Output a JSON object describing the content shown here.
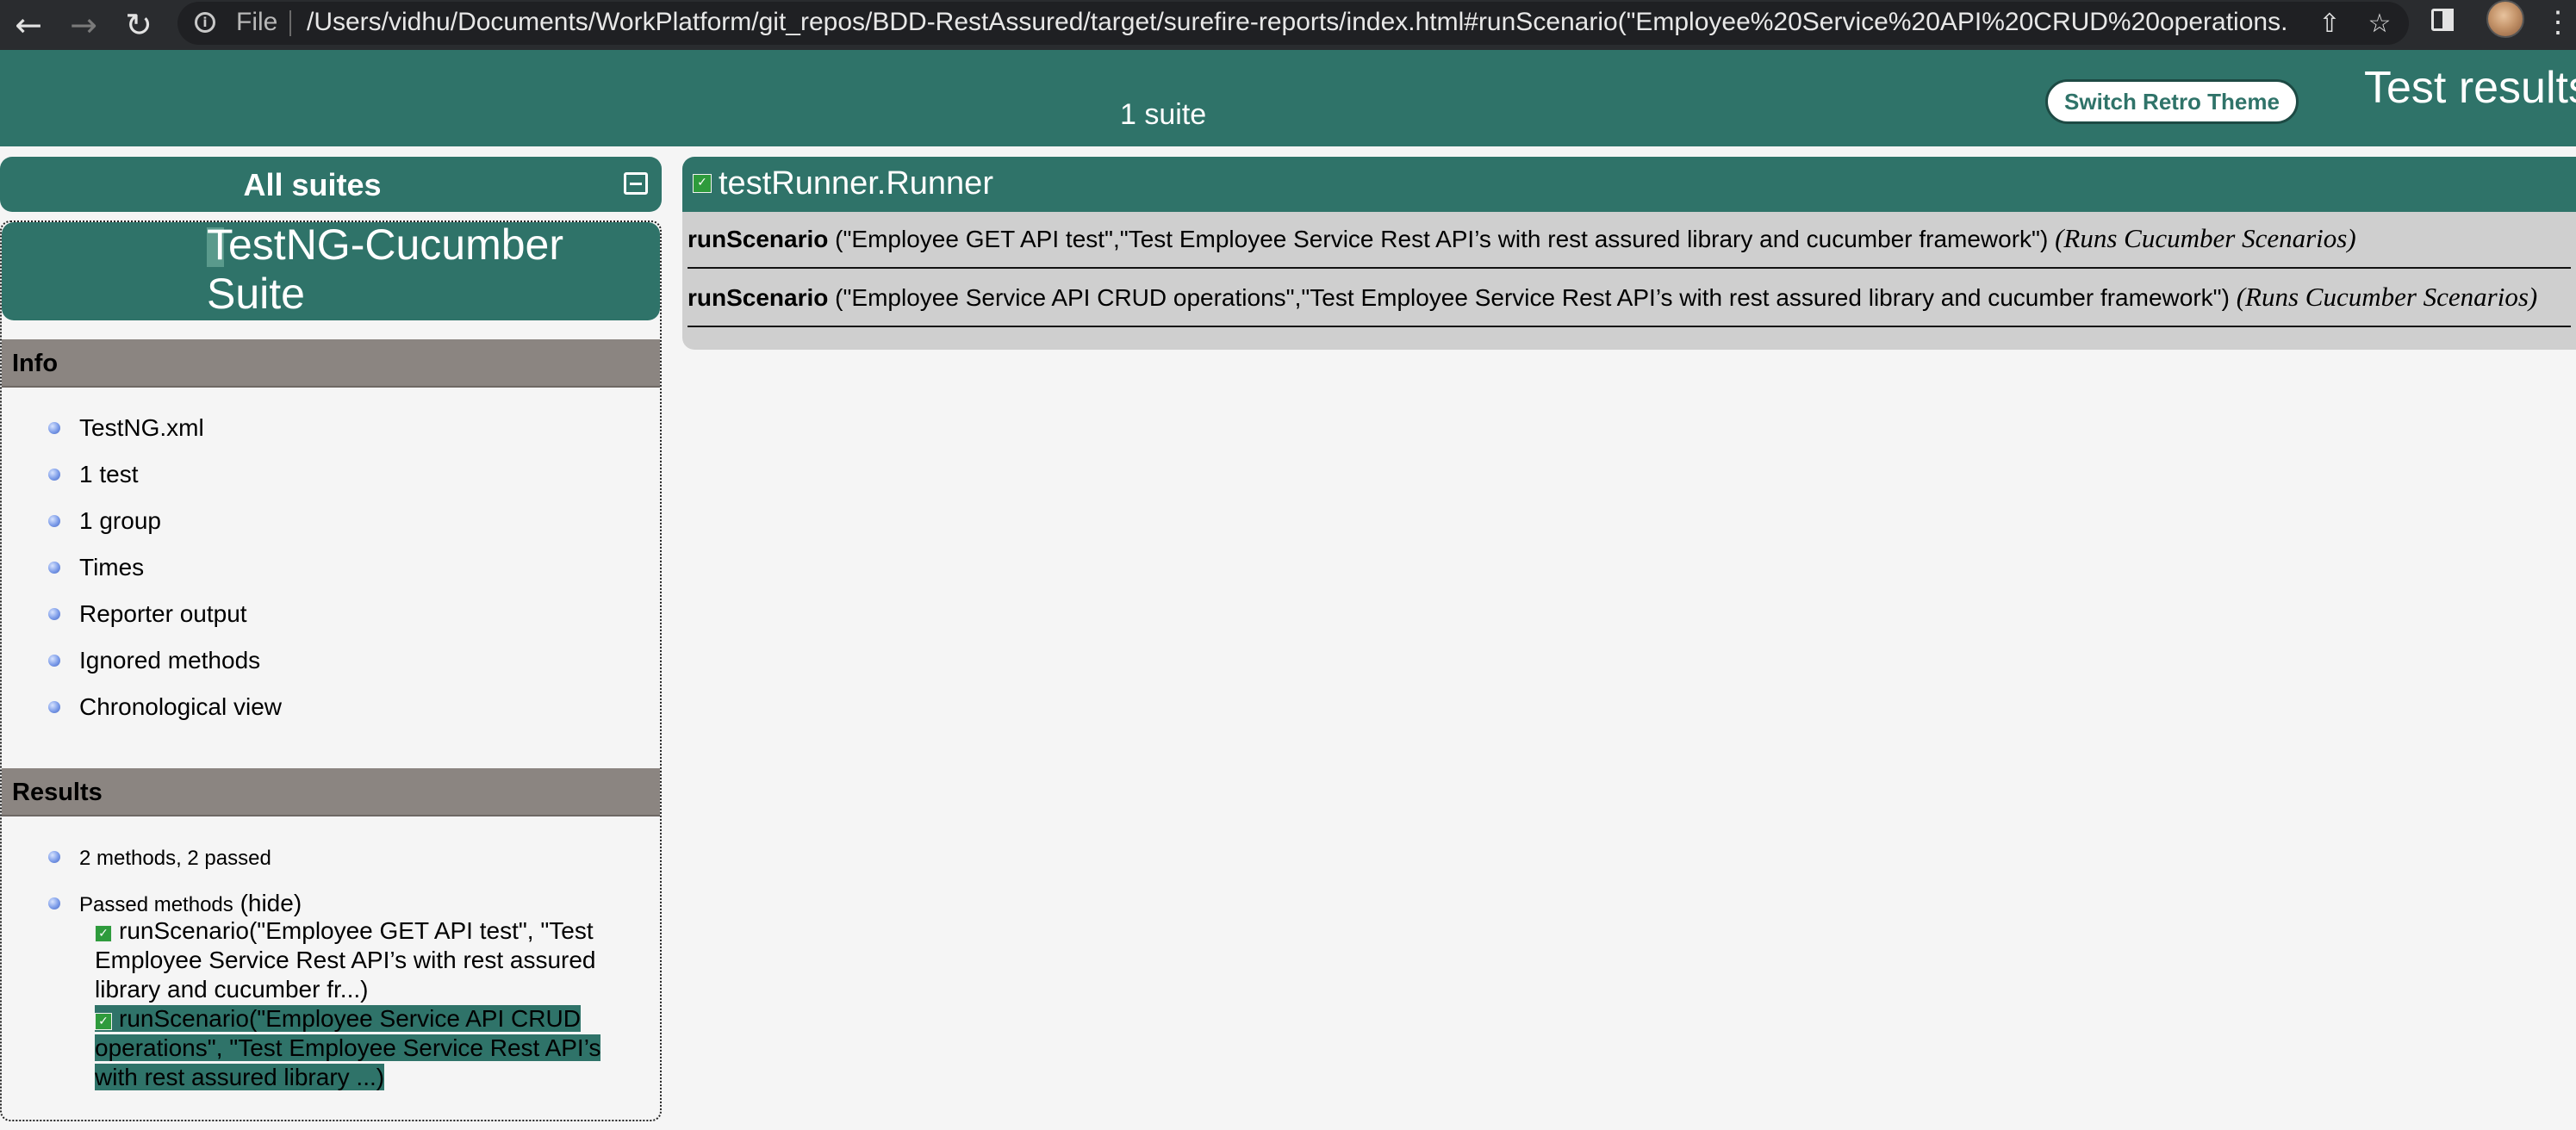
{
  "browser": {
    "file_label": "File",
    "url": "/Users/vidhu/Documents/WorkPlatform/git_repos/BDD-RestAssured/target/surefire-reports/index.html#runScenario(\"Employee%20Service%20API%20CRUD%20operations..."
  },
  "header": {
    "suite_count": "1 suite",
    "retro_button": "Switch Retro Theme",
    "title": "Test results"
  },
  "sidebar": {
    "all_suites": "All suites",
    "suite_name": "TestNG-Cucumber Suite",
    "info_title": "Info",
    "info_items": [
      "TestNG.xml",
      "1 test",
      "1 group",
      "Times",
      "Reporter output",
      "Ignored methods",
      "Chronological view"
    ],
    "results_title": "Results",
    "summary": "2 methods, 2 passed",
    "passed_label": "Passed methods",
    "hide_label": "(hide)",
    "passed_methods": [
      "runScenario(\"Employee GET API test\", \"Test Employee Service Rest API’s with rest assured library and cucumber fr...)",
      "runScenario(\"Employee Service API CRUD operations\", \"Test Employee Service Rest API’s with rest assured library ...)"
    ]
  },
  "main": {
    "class_name": "testRunner.Runner",
    "methods": [
      {
        "name": "runScenario",
        "params": " (\"Employee GET API test\",\"Test Employee Service Rest API’s with rest assured library and cucumber framework\") ",
        "description": "(Runs Cucumber Scenarios)"
      },
      {
        "name": "runScenario",
        "params": " (\"Employee Service API CRUD operations\",\"Test Employee Service Rest API’s with rest assured library and cucumber framework\") ",
        "description": "(Runs Cucumber Scenarios)"
      }
    ]
  },
  "colors": {
    "theme_green": "#2f7369",
    "section_grey": "#8b8581",
    "method_box_grey": "#cfcfcf",
    "page_bg": "#f5f5f5"
  }
}
